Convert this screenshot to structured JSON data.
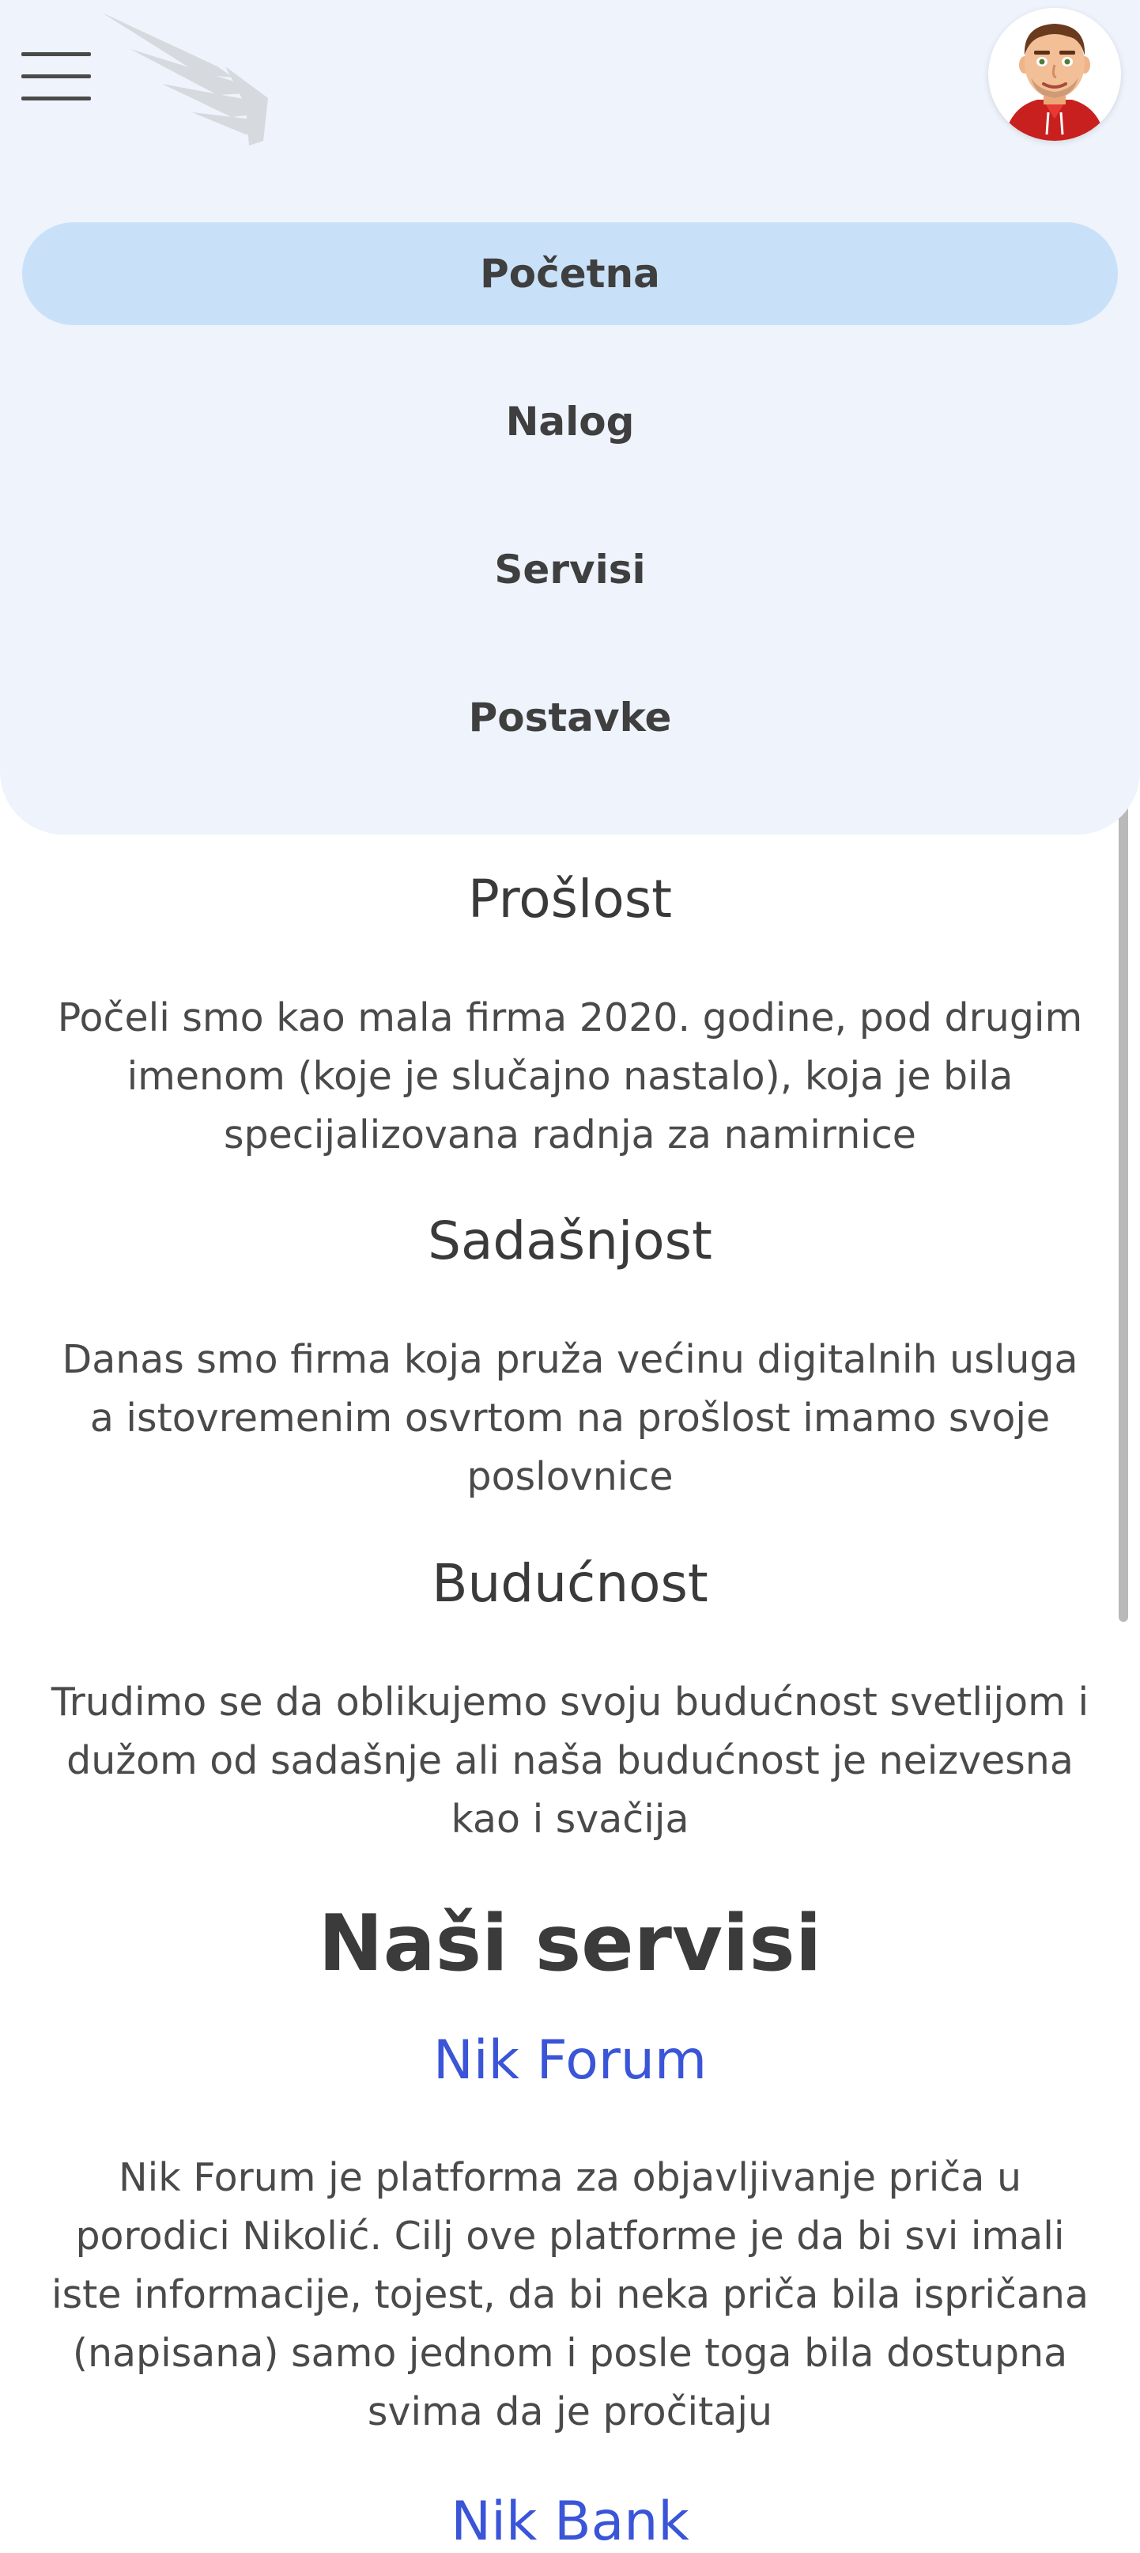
{
  "nav": {
    "items": [
      {
        "label": "Početna",
        "active": true
      },
      {
        "label": "Nalog",
        "active": false
      },
      {
        "label": "Servisi",
        "active": false
      },
      {
        "label": "Postavke",
        "active": false
      }
    ]
  },
  "sections": [
    {
      "title": "Prošlost",
      "text": "Počeli smo kao mala firma 2020. godine, pod drugim imenom (koje je slučajno nastalo), koja je bila specijalizovana radnja za namirnice"
    },
    {
      "title": "Sadašnjost",
      "text": "Danas smo firma koja pruža većinu digitalnih usluga a istovremenim osvrtom na prošlost imamo svoje poslovnice"
    },
    {
      "title": "Budućnost",
      "text": "Trudimo se da oblikujemo svoju budućnost svetlijom i dužom od sadašnje ali naša budućnost je neizvesna kao i svačija"
    }
  ],
  "services": {
    "heading": "Naši servisi",
    "items": [
      {
        "name": "Nik Forum",
        "description": "Nik Forum je platforma za objavljivanje priča u porodici Nikolić. Cilj ove platforme je da bi svi imali iste informacije, tojest, da bi neka priča bila ispričana (napisana) samo jednom i posle toga bila dostupna svima da je pročitaju"
      },
      {
        "name": "Nik Bank",
        "description": ""
      }
    ]
  },
  "colors": {
    "menu_background": "#eef3fc",
    "active_item": "#c9e1f8",
    "link": "#3a55d8",
    "text": "#4a4a4a"
  },
  "icons": {
    "menu": "hamburger-icon",
    "logo": "wing-logo",
    "avatar": "user-avatar"
  }
}
